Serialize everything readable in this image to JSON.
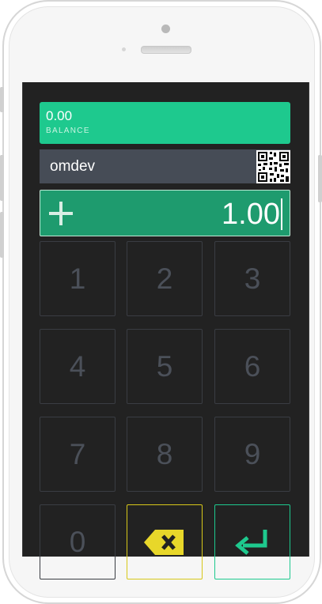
{
  "balance": {
    "value": "0.00",
    "label": "BALANCE"
  },
  "account": {
    "name": "omdev"
  },
  "amount": {
    "value": "1.00",
    "operator_icon": "plus-icon"
  },
  "keypad": {
    "keys": [
      "1",
      "2",
      "3",
      "4",
      "5",
      "6",
      "7",
      "8",
      "9",
      "0"
    ],
    "delete_icon": "backspace-icon",
    "enter_icon": "enter-icon"
  },
  "colors": {
    "accent_green": "#1ec98e",
    "amount_green": "#1e9b6e",
    "delete_yellow": "#d7c81a",
    "screen_bg": "#222222",
    "account_bar": "#464c56"
  }
}
